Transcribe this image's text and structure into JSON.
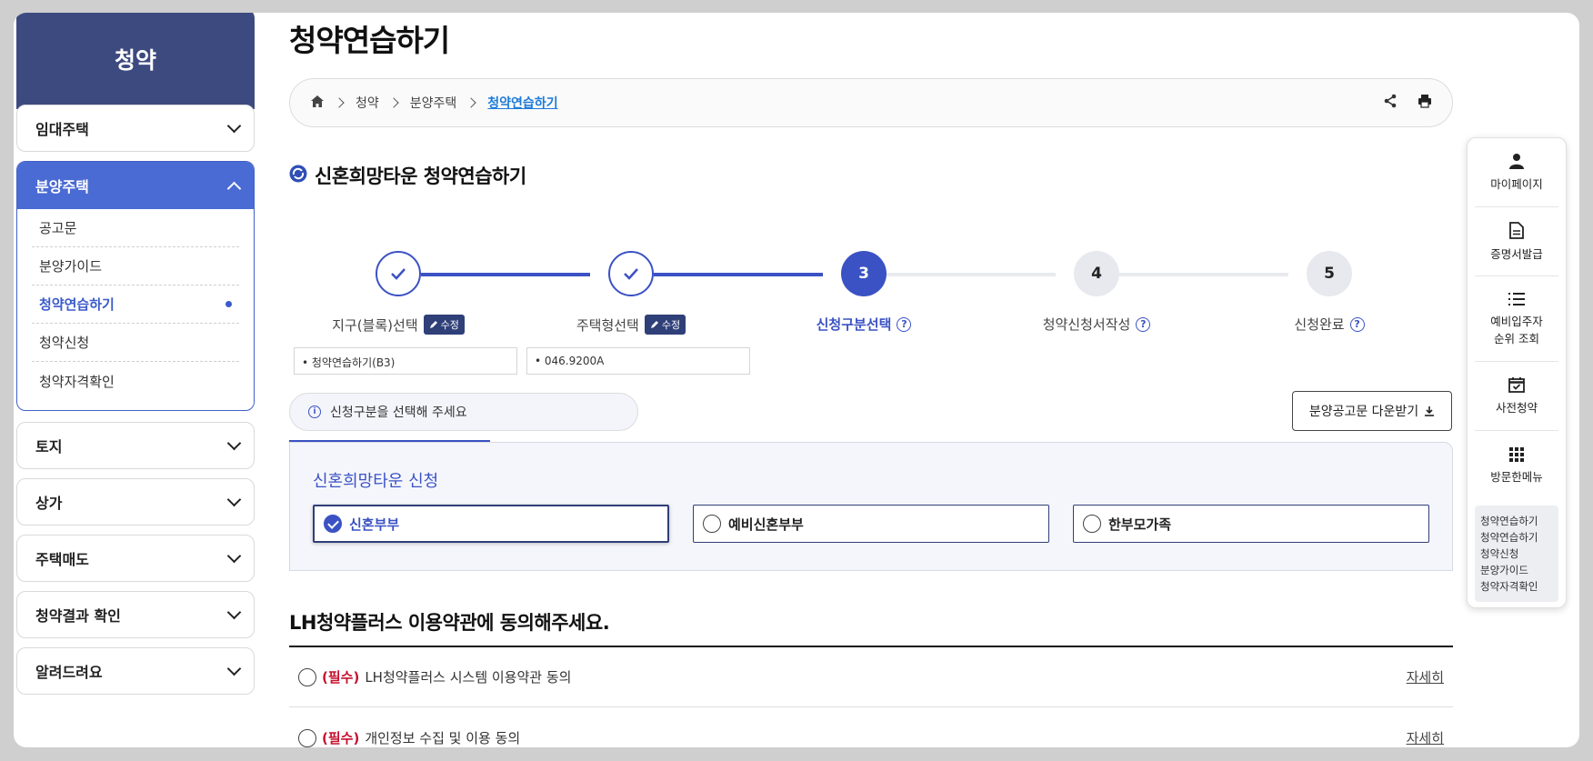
{
  "sidebar": {
    "header": "청약",
    "menus_top": [
      "임대주택"
    ],
    "open_group": {
      "label": "분양주택",
      "items": [
        "공고문",
        "분양가이드",
        "청약연습하기",
        "청약신청",
        "청약자격확인"
      ]
    },
    "menus_bottom": [
      "토지",
      "상가",
      "주택매도",
      "청약결과 확인",
      "알려드려요"
    ]
  },
  "page": {
    "title": "청약연습하기"
  },
  "breadcrumb": {
    "items": [
      "청약",
      "분양주택"
    ],
    "current": "청약연습하기"
  },
  "section": {
    "title": "신혼희망타운 청약연습하기"
  },
  "stepper": {
    "steps": [
      {
        "number": "",
        "label": "지구(블록)선택",
        "state": "done",
        "edit": "수정",
        "value": "• 청약연습하기(B3)"
      },
      {
        "number": "",
        "label": "주택형선택",
        "state": "done",
        "edit": "수정",
        "value": "• 046.9200A"
      },
      {
        "number": "3",
        "label": "신청구분선택",
        "state": "current",
        "help": "?"
      },
      {
        "number": "4",
        "label": "청약신청서작성",
        "state": "todo",
        "help": "?"
      },
      {
        "number": "5",
        "label": "신청완료",
        "state": "todo",
        "help": "?"
      }
    ]
  },
  "notice": {
    "icon": "i",
    "text": "신청구분을 선택해 주세요"
  },
  "download_button": {
    "label": "분양공고문 다운받기"
  },
  "apply": {
    "title": "신혼희망타운 신청",
    "options": [
      "신혼부부",
      "예비신혼부부",
      "한부모가족"
    ],
    "selected": "신혼부부"
  },
  "terms": {
    "title": "LH청약플러스 이용약관에 동의해주세요.",
    "rows": [
      {
        "tag": "(필수)",
        "text": "LH청약플러스 시스템 이용약관 동의",
        "more": "자세히"
      },
      {
        "tag": "(필수)",
        "text": "개인정보 수집 및 이용 동의",
        "more": "자세히"
      }
    ]
  },
  "quick_menu": {
    "items": [
      "마이페이지",
      "증명서발급",
      "예비입주자\n순위 조회",
      "사전청약",
      "방문한메뉴"
    ],
    "recent": [
      "청약연습하기",
      "청약연습하기",
      "청약신청",
      "분양가이드",
      "청약자격확인"
    ]
  },
  "colors": {
    "primary": "#3b52c4",
    "sidebar_head": "#3d4a80",
    "required": "#c8102e"
  }
}
